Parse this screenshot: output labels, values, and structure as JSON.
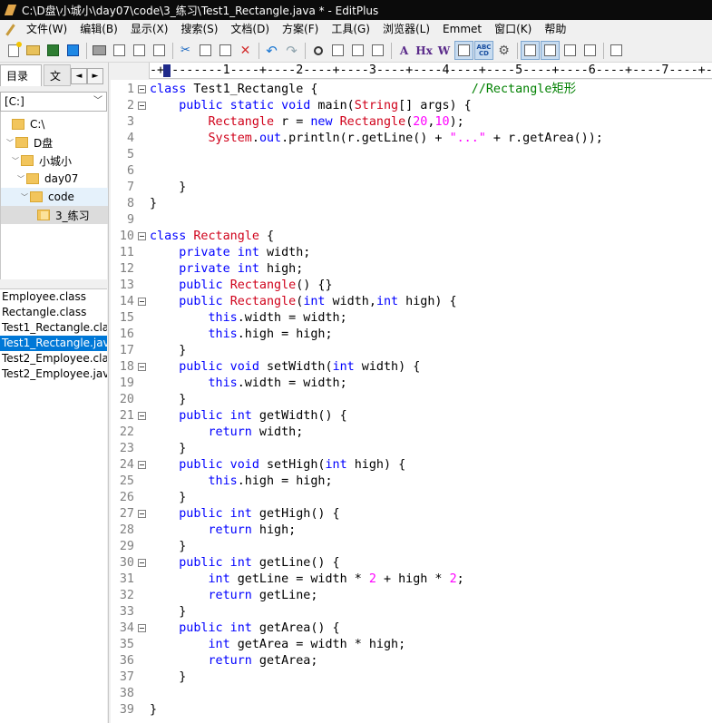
{
  "window": {
    "title": "C:\\D盘\\小城小\\day07\\code\\3_练习\\Test1_Rectangle.java * - EditPlus"
  },
  "menu": [
    "文件(W)",
    "编辑(B)",
    "显示(X)",
    "搜索(S)",
    "文档(D)",
    "方案(F)",
    "工具(G)",
    "浏览器(L)",
    "Emmet",
    "窗口(K)",
    "帮助"
  ],
  "toolbar": {
    "find_text_label": "A",
    "hex_label": "Hx",
    "word_label": "W",
    "spell_label": "ABC",
    "spell_label_2": "CD"
  },
  "ruler": "-+--------1----+----2----+----3----+----4----+----5----+----6----+----7----+--",
  "sidebar": {
    "tabs": [
      "目录",
      "文本"
    ],
    "arrows": [
      "◄",
      "►"
    ],
    "drive": "[C:]",
    "tree": [
      {
        "label": "C:\\",
        "indent": 0
      },
      {
        "label": "D盘",
        "indent": 1
      },
      {
        "label": "小城小",
        "indent": 2
      },
      {
        "label": "day07",
        "indent": 3
      },
      {
        "label": "code",
        "indent": 4
      },
      {
        "label": "3_练习",
        "indent": 5
      }
    ],
    "files": [
      "Employee.class",
      "Rectangle.class",
      "Test1_Rectangle.cla",
      "Test1_Rectangle.jav",
      "Test2_Employee.cla",
      "Test2_Employee.jav"
    ],
    "selected_file_index": 3
  },
  "code": [
    {
      "n": "1",
      "fold": true,
      "html": "<span class=\"k\">class</span> Test1_Rectangle {                     <span class=\"c\">//Rectangle矩形</span>"
    },
    {
      "n": "2",
      "fold": true,
      "html": "    <span class=\"k\">public static void</span> main(<span class=\"t\">String</span>[] args) {"
    },
    {
      "n": "3",
      "fold": false,
      "html": "        <span class=\"t\">Rectangle</span> r = <span class=\"k\">new</span> <span class=\"t\">Rectangle</span>(<span class=\"n\">20</span>,<span class=\"n\">10</span>);"
    },
    {
      "n": "4",
      "fold": false,
      "html": "        <span class=\"t\">System</span>.<span class=\"k\">out</span>.println(r.getLine() + <span class=\"s\">\"...\"</span> + r.getArea());"
    },
    {
      "n": "5",
      "fold": false,
      "html": ""
    },
    {
      "n": "6",
      "fold": false,
      "html": ""
    },
    {
      "n": "7",
      "fold": false,
      "html": "    }"
    },
    {
      "n": "8",
      "fold": false,
      "html": "}"
    },
    {
      "n": "9",
      "fold": false,
      "html": ""
    },
    {
      "n": "10",
      "fold": true,
      "html": "<span class=\"k\">class</span> <span class=\"t\">Rectangle</span> {"
    },
    {
      "n": "11",
      "fold": false,
      "html": "    <span class=\"k\">private int</span> width;"
    },
    {
      "n": "12",
      "fold": false,
      "html": "    <span class=\"k\">private int</span> high;"
    },
    {
      "n": "13",
      "fold": false,
      "html": "    <span class=\"k\">public</span> <span class=\"t\">Rectangle</span>() {}"
    },
    {
      "n": "14",
      "fold": true,
      "html": "    <span class=\"k\">public</span> <span class=\"t\">Rectangle</span>(<span class=\"k\">int</span> width,<span class=\"k\">int</span> high) {"
    },
    {
      "n": "15",
      "fold": false,
      "html": "        <span class=\"k\">this</span>.width = width;"
    },
    {
      "n": "16",
      "fold": false,
      "html": "        <span class=\"k\">this</span>.high = high;"
    },
    {
      "n": "17",
      "fold": false,
      "html": "    }"
    },
    {
      "n": "18",
      "fold": true,
      "html": "    <span class=\"k\">public void</span> setWidth(<span class=\"k\">int</span> width) {"
    },
    {
      "n": "19",
      "fold": false,
      "html": "        <span class=\"k\">this</span>.width = width;"
    },
    {
      "n": "20",
      "fold": false,
      "html": "    }"
    },
    {
      "n": "21",
      "fold": true,
      "html": "    <span class=\"k\">public int</span> getWidth() {"
    },
    {
      "n": "22",
      "fold": false,
      "html": "        <span class=\"k\">return</span> width;"
    },
    {
      "n": "23",
      "fold": false,
      "html": "    }"
    },
    {
      "n": "24",
      "fold": true,
      "html": "    <span class=\"k\">public void</span> setHigh(<span class=\"k\">int</span> high) {"
    },
    {
      "n": "25",
      "fold": false,
      "html": "        <span class=\"k\">this</span>.high = high;"
    },
    {
      "n": "26",
      "fold": false,
      "html": "    }"
    },
    {
      "n": "27",
      "fold": true,
      "html": "    <span class=\"k\">public int</span> getHigh() {"
    },
    {
      "n": "28",
      "fold": false,
      "html": "        <span class=\"k\">return</span> high;"
    },
    {
      "n": "29",
      "fold": false,
      "html": "    }"
    },
    {
      "n": "30",
      "fold": true,
      "html": "    <span class=\"k\">public int</span> getLine() {"
    },
    {
      "n": "31",
      "fold": false,
      "html": "        <span class=\"k\">int</span> getLine = width * <span class=\"n\">2</span> + high * <span class=\"n\">2</span>;"
    },
    {
      "n": "32",
      "fold": false,
      "html": "        <span class=\"k\">return</span> getLine;"
    },
    {
      "n": "33",
      "fold": false,
      "html": "    }"
    },
    {
      "n": "34",
      "fold": true,
      "html": "    <span class=\"k\">public int</span> getArea() {"
    },
    {
      "n": "35",
      "fold": false,
      "html": "        <span class=\"k\">int</span> getArea = width * high;"
    },
    {
      "n": "36",
      "fold": false,
      "html": "        <span class=\"k\">return</span> getArea;"
    },
    {
      "n": "37",
      "fold": false,
      "html": "    }"
    },
    {
      "n": "38",
      "fold": false,
      "html": ""
    },
    {
      "n": "39",
      "fold": false,
      "html": "}"
    }
  ],
  "colors": {
    "keyword": "#0000ff",
    "type": "#d0021b",
    "string": "#ff00ff",
    "comment": "#008000",
    "selection": "#0078d7"
  }
}
